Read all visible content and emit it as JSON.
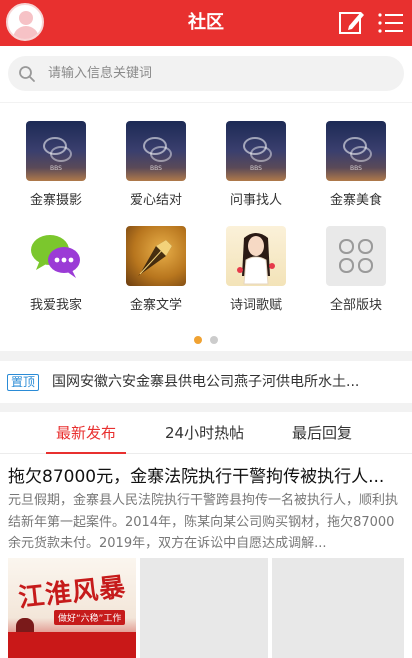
{
  "header": {
    "title": "社区",
    "avatar_icon": "user-avatar",
    "edit_icon": "compose-icon",
    "menu_icon": "menu-icon",
    "brand_color": "#e8302f"
  },
  "search": {
    "placeholder": "请输入信息关键词",
    "icon": "search-icon"
  },
  "forums": [
    {
      "label": "金寨摄影",
      "image": "bbs-thumb"
    },
    {
      "label": "爱心结对",
      "image": "bbs-thumb"
    },
    {
      "label": "问事找人",
      "image": "bbs-thumb"
    },
    {
      "label": "金寨美食",
      "image": "bbs-thumb"
    },
    {
      "label": "我爱我家",
      "image": "chat-bubbles"
    },
    {
      "label": "金寨文学",
      "image": "fountain-pen"
    },
    {
      "label": "诗词歌赋",
      "image": "poetry-girl"
    },
    {
      "label": "全部版块",
      "image": "grid-icon"
    }
  ],
  "carousel": {
    "pages": 2,
    "active": 1,
    "active_color": "#f0a232"
  },
  "notice": {
    "badge": "置顶",
    "text": "国网安徽六安金寨县供电公司燕子河供电所水土..."
  },
  "tabs": [
    {
      "label": "最新发布",
      "active": true
    },
    {
      "label": "24小时热帖",
      "active": false
    },
    {
      "label": "最后回复",
      "active": false
    }
  ],
  "post": {
    "title": "拖欠87000元，金寨法院执行干警拘传被执行人...",
    "excerpt": "元旦假期，金寨县人民法院执行干警跨县拘传一名被执行人，顺利执结新年第一起案件。2014年，陈某向某公司购买钢材，拖欠87000余元货款未付。2019年，双方在诉讼中自愿达成调解...",
    "image1_calligraphy": "江淮风暴",
    "image1_strip": "做好“六稳”工作"
  }
}
